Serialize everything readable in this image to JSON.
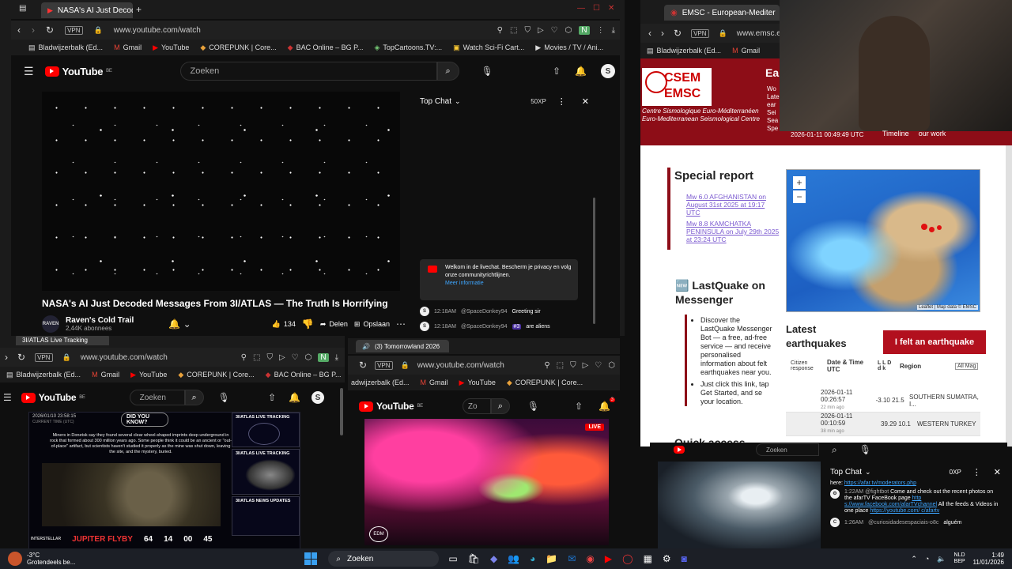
{
  "main_window": {
    "tab_title": "NASA's AI Just Decoded",
    "url": "www.youtube.com/watch",
    "vpn": "VPN",
    "bookmarks": [
      "Bladwijzerbalk (Ed...",
      "Gmail",
      "YouTube",
      "COREPUNK | Core...",
      "BAC Online – BG P...",
      "TopCartoons.TV:...",
      "Watch Sci-Fi Cart...",
      "Movies / TV / Ani..."
    ],
    "youtube": {
      "logo": "YouTube",
      "region": "BE",
      "search_placeholder": "Zoeken",
      "avatar": "S",
      "video_title": "NASA's AI Just Decoded Messages From 3I/ATLAS — The Truth Is Horrifying",
      "channel": "Raven's Cold Trail",
      "subscribers": "2,44K abonnees",
      "likes": "134",
      "share": "Delen",
      "save": "Opslaan"
    },
    "chat": {
      "title": "Top Chat",
      "xp": "50XP",
      "welcome": "Welkom in de livechat. Bescherm je privacy en volg onze communityrichtlijnen.",
      "more_info": "Meer informatie",
      "messages": [
        {
          "time": "12:18AM",
          "user": "@SpaceDonkey94",
          "badge": "",
          "text": "Greeting sir"
        },
        {
          "time": "12:18AM",
          "user": "@SpaceDonkey94",
          "badge": "#3",
          "text": "are aliens"
        }
      ]
    }
  },
  "emsc_window": {
    "tab_title": "EMSC - European-Mediter",
    "url": "www.emsc.eu",
    "vpn": "VPN",
    "bookmarks": [
      "Bladwijzerbalk (Ed...",
      "Gmail"
    ],
    "logo_top": "CSEM",
    "logo_bottom": "EMSC",
    "org_fr": "Centre Sismologique Euro-Méditerranéen",
    "org_en": "Euro-Mediterranean Seismological Centre",
    "header_cut": "Ea",
    "header_side": [
      "Wo",
      "Late",
      "ear",
      "Sei",
      "Sea",
      "Spe"
    ],
    "datetime": "2026-01-11 00:49:49 UTC",
    "nav": [
      "Timeline",
      "our work"
    ],
    "special_report_title": "Special report",
    "special_links": [
      "Mw 6.0 AFGHANISTAN on August 31st 2025 at 19:17 UTC",
      "Mw 8.8 KAMCHATKA PENINSULA on July 29th 2025 at 23:24 UTC"
    ],
    "map_attr": "Leaflet | Map data © EMSC",
    "lastquake_title": "🆕 LastQuake on Messenger",
    "lastquake_items": [
      "Discover the LastQuake Messenger Bot — a free, ad-free service — and receive personalised information about felt earthquakes near you.",
      "Just click this link, tap Get Started, and se your location."
    ],
    "latest_title": "Latest earthquakes",
    "felt_button": "I felt an earthquake",
    "table_headers": [
      "Citizen response",
      "Date & Time UTC",
      "L L D d k",
      "Region"
    ],
    "mag_select": "All Mag",
    "quakes": [
      {
        "date": "2026-01-11",
        "time": "00:26:57",
        "ago": "22 min ago",
        "values": "-3.10 21.5",
        "region": "SOUTHERN SUMATRA, I..."
      },
      {
        "date": "2026-01-11",
        "time": "00:10:59",
        "ago": "38 min ago",
        "values": "39.29 10.1",
        "region": "WESTERN TURKEY"
      }
    ],
    "quick_access": "Quick access"
  },
  "tracker_window": {
    "tab_title": "3I/ATLAS Live Tracking",
    "url": "www.youtube.com/watch",
    "vpn": "VPN",
    "bookmarks": [
      "Bladwijzerbalk (Ed...",
      "Gmail",
      "YouTube",
      "COREPUNK | Core...",
      "BAC Online – BG P..."
    ],
    "logo": "YouTube",
    "region": "BE",
    "search_placeholder": "Zoeken",
    "avatar": "S",
    "stream_datetime": "2026/01/10 23:58:15",
    "current_time_label": "CURRENT TIME (UTC)",
    "did_you_know": "DID YOU KNOW?",
    "fact": "Miners in Donetsk say they found several clear wheel-shaped imprints deep underground in rock that formed about 300 million years ago. Some people think it could be an ancient or \"out-of-place\" artifact, but scientists haven't studied it properly as the mine was shut down, leaving the site, and the mystery, buried.",
    "tracking_label": "3I/ATLAS LIVE TRACKING",
    "news_label": "3I/ATLAS NEWS UPDATES",
    "footer": "JUPITER FLYBY",
    "countdown": [
      "64",
      "14",
      "00",
      "45"
    ],
    "brand": "INTERSTELLAR"
  },
  "tomorrowland_window": {
    "tab_title": "(3) Tomorrowland 2026",
    "url": "www.youtube.com/watch",
    "vpn": "VPN",
    "bookmarks": [
      "adwijzerbalk (Ed...",
      "Gmail",
      "YouTube",
      "COREPUNK | Core..."
    ],
    "logo": "YouTube",
    "region": "BE",
    "search_placeholder": "Zo",
    "notif_count": "3",
    "live_badge": "LIVE",
    "dj_logo": "EDM"
  },
  "small_window": {
    "search_placeholder": "Zoeken",
    "chat_title": "Top Chat",
    "xp": "0XP",
    "pinned_prefix": "here:",
    "pinned_link": "https://afar.tv/moderators.php",
    "message_time": "1:22AM",
    "message_user": "@fightbot",
    "message_text": "Come and check out the recent photos on the afarTV FaceBook page",
    "message_link1": "http s://www.facebook.com/afarTVchannel",
    "message_mid": "All the feeds & Videos in one place",
    "message_link2": "https://youtube.com/ c/afartv",
    "message2_time": "1:26AM",
    "message2_user": "@curiosidadesespaciais-o8c",
    "message2_text": "alguém"
  },
  "taskbar": {
    "weather_temp": "-3°C",
    "weather_desc": "Grotendeels be...",
    "search_label": "Zoeken",
    "lang_top": "NLD",
    "lang_bottom": "BEP",
    "time": "1:49",
    "date": "11/01/2026"
  },
  "colors": {
    "youtube_red": "#ff0000",
    "emsc_red": "#b2101e",
    "chat_bg": "#0f0f0f",
    "taskbar": "#1c1f26"
  }
}
